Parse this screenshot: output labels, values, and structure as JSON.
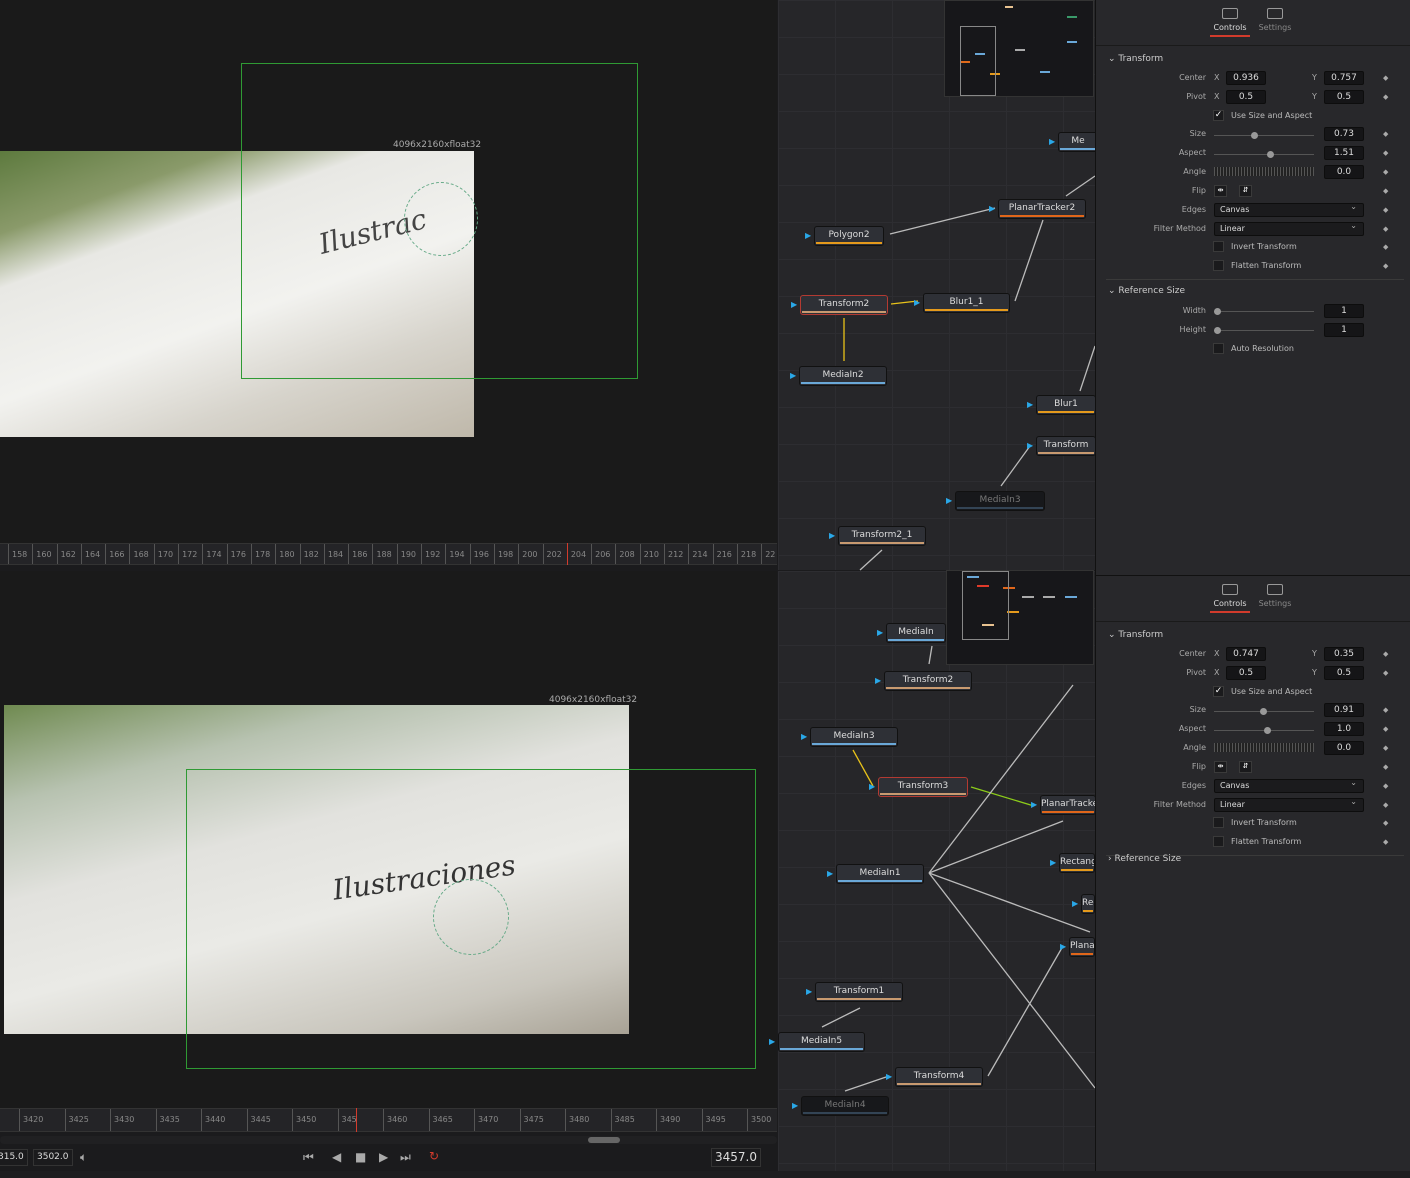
{
  "top_viewer": {
    "resolution": "4096x2160xfloat32",
    "ruler": [
      "158",
      "160",
      "162",
      "164",
      "166",
      "168",
      "170",
      "172",
      "174",
      "176",
      "178",
      "180",
      "182",
      "184",
      "186",
      "188",
      "190",
      "192",
      "194",
      "196",
      "198",
      "200",
      "202",
      "204",
      "206",
      "208",
      "210",
      "212",
      "214",
      "216",
      "218",
      "22"
    ]
  },
  "bottom_viewer": {
    "resolution": "4096x2160xfloat32",
    "ruler": [
      "3420",
      "3425",
      "3430",
      "3435",
      "3440",
      "3445",
      "3450",
      "345",
      "3460",
      "3465",
      "3470",
      "3475",
      "3480",
      "3485",
      "3490",
      "3495",
      "3500"
    ]
  },
  "transport": {
    "start": "315.0",
    "end": "3502.0",
    "current": "3457.0",
    "icons": [
      "volume-icon",
      "go-to-start-icon",
      "play-reverse-icon",
      "stop-icon",
      "play-icon",
      "go-to-end-icon",
      "loop-icon"
    ]
  },
  "top_nodes": [
    "Me",
    "PlanarTracker2",
    "Polygon2",
    "Transform2",
    "Blur1_1",
    "MediaIn2",
    "Blur1",
    "Transform",
    "MediaIn3",
    "Transform2_1"
  ],
  "bottom_nodes": [
    "MediaIn",
    "Transform2",
    "MediaIn3",
    "Transform3",
    "PlanarTracker",
    "Rectangl",
    "Rec",
    "Planar",
    "MediaIn1",
    "Transform1",
    "MediaIn5",
    "Transform4",
    "MediaIn4"
  ],
  "inspectors": [
    {
      "tabs": [
        "Controls",
        "Settings"
      ],
      "section": "Transform",
      "center_label": "Center",
      "pivot_label": "Pivot",
      "x": "X",
      "y": "Y",
      "center_x": "0.936",
      "center_y": "0.757",
      "pivot_x": "0.5",
      "pivot_y": "0.5",
      "use_size": "Use Size and Aspect",
      "size_label": "Size",
      "size": "0.73",
      "aspect_label": "Aspect",
      "aspect": "1.51",
      "angle_label": "Angle",
      "angle": "0.0",
      "flip_label": "Flip",
      "edges_label": "Edges",
      "edges": "Canvas",
      "filter_label": "Filter Method",
      "filter": "Linear",
      "invert": "Invert Transform",
      "flatten": "Flatten Transform",
      "ref_section": "Reference Size",
      "width_label": "Width",
      "width": "1",
      "height_label": "Height",
      "height": "1",
      "auto_res": "Auto Resolution"
    },
    {
      "tabs": [
        "Controls",
        "Settings"
      ],
      "section": "Transform",
      "center_label": "Center",
      "pivot_label": "Pivot",
      "x": "X",
      "y": "Y",
      "center_x": "0.747",
      "center_y": "0.35",
      "pivot_x": "0.5",
      "pivot_y": "0.5",
      "use_size": "Use Size and Aspect",
      "size_label": "Size",
      "size": "0.91",
      "aspect_label": "Aspect",
      "aspect": "1.0",
      "angle_label": "Angle",
      "angle": "0.0",
      "flip_label": "Flip",
      "edges_label": "Edges",
      "edges": "Canvas",
      "filter_label": "Filter Method",
      "filter": "Linear",
      "invert": "Invert Transform",
      "flatten": "Flatten Transform",
      "ref_section": "Reference Size"
    }
  ],
  "colors": {
    "selection": "#b33a32",
    "tool_bar": "#e59a1c",
    "media_bar": "#6aa8d8",
    "tracker_bar": "#e0661a",
    "guide": "#2f9a34",
    "playhead": "#d23b2c"
  }
}
